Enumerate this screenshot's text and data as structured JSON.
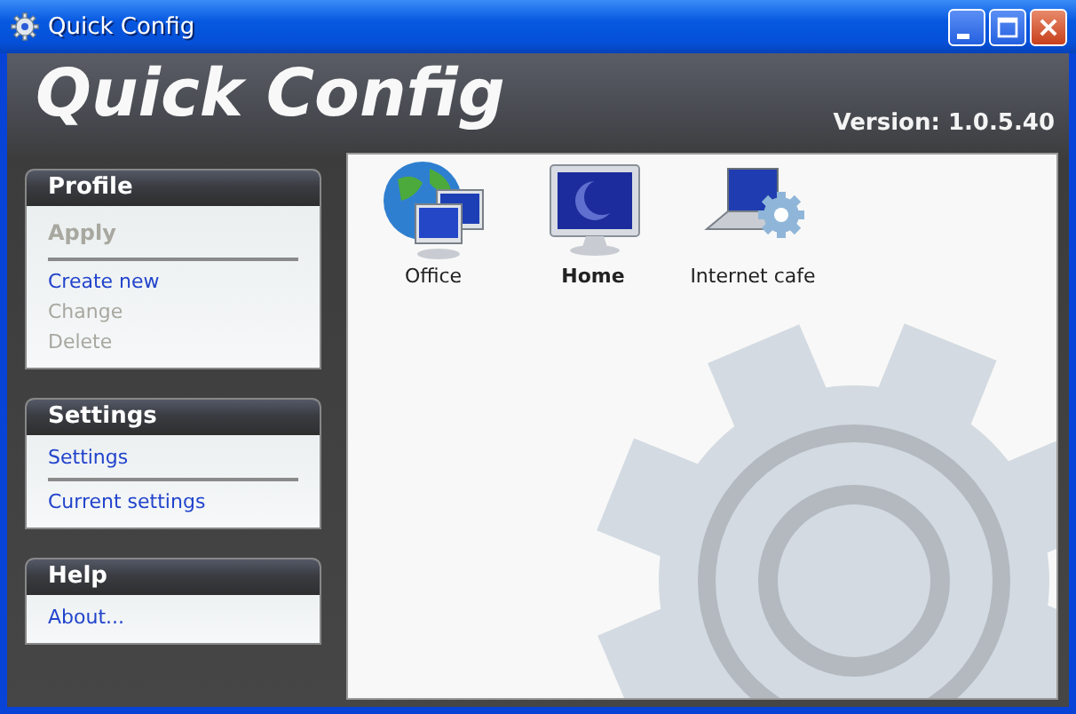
{
  "window": {
    "title": "Quick Config"
  },
  "header": {
    "title": "Quick Config",
    "version": "Version: 1.0.5.40"
  },
  "panels": [
    {
      "title": "Profile",
      "groups": [
        {
          "items": [
            {
              "label": "Apply",
              "kind": "primary",
              "disabled": true
            }
          ]
        },
        {
          "items": [
            {
              "label": "Create new",
              "kind": "link",
              "disabled": false
            },
            {
              "label": "Change",
              "kind": "link",
              "disabled": true
            },
            {
              "label": "Delete",
              "kind": "link",
              "disabled": true
            }
          ]
        }
      ]
    },
    {
      "title": "Settings",
      "groups": [
        {
          "items": [
            {
              "label": "Settings",
              "kind": "link",
              "disabled": false
            }
          ]
        },
        {
          "items": [
            {
              "label": "Current settings",
              "kind": "link",
              "disabled": false
            }
          ]
        }
      ]
    },
    {
      "title": "Help",
      "groups": [
        {
          "items": [
            {
              "label": "About...",
              "kind": "link",
              "disabled": false
            }
          ]
        }
      ]
    }
  ],
  "profiles": [
    {
      "label": "Office",
      "kind": "office",
      "selected": false
    },
    {
      "label": "Home",
      "kind": "home",
      "selected": true
    },
    {
      "label": "Internet cafe",
      "kind": "laptop",
      "selected": false
    }
  ]
}
